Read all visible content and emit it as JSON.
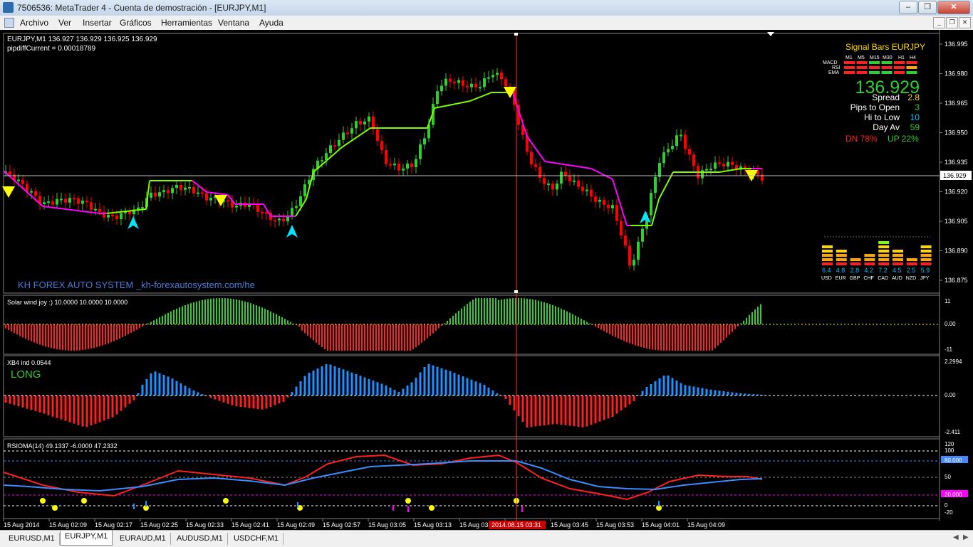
{
  "window": {
    "title": "7506536: MetaTrader 4 - Cuenta de demostración - [EURJPY,M1]"
  },
  "menu": {
    "items": [
      "Archivo",
      "Ver",
      "Insertar",
      "Gráficos",
      "Herramientas",
      "Ventana",
      "Ayuda"
    ]
  },
  "chart": {
    "header": "EURJPY,M1  136.927 136.929 136.925 136.929",
    "pipdiff": "pipdiffCurrent = 0.00018789",
    "watermark": "KH FOREX AUTO SYSTEM _kh-forexautosystem.com/he",
    "current_price": "136.929",
    "price_labels": [
      "136.995",
      "136.980",
      "136.965",
      "136.950",
      "136.935",
      "136.920",
      "136.905",
      "136.890",
      "136.875"
    ],
    "time_labels": [
      "15 Aug 2014",
      "15 Aug 02:09",
      "15 Aug 02:17",
      "15 Aug 02:25",
      "15 Aug 02:33",
      "15 Aug 02:41",
      "15 Aug 02:49",
      "15 Aug 02:57",
      "15 Aug 03:05",
      "15 Aug 03:13",
      "15 Aug 03",
      "15 Aug 03:37",
      "15 Aug 03:45",
      "15 Aug 03:53",
      "15 Aug 04:01",
      "15 Aug 04:09"
    ],
    "crosshair_time": "2014.08.15 03:31"
  },
  "signal_panel": {
    "title": "Signal Bars EURJPY",
    "timeframes": [
      "M1",
      "M5",
      "M15",
      "M30",
      "H1",
      "H4"
    ],
    "rows": [
      "MACD",
      "RSI",
      "EMA"
    ],
    "price": "136.929",
    "stats": [
      {
        "label": "Spread",
        "value": "2.8"
      },
      {
        "label": "Pips to Open",
        "value": "3"
      },
      {
        "label": "Hi to Low",
        "value": "10"
      },
      {
        "label": "Day Av",
        "value": "59"
      }
    ],
    "dn": "DN 78%",
    "up": "UP 22%"
  },
  "strength": {
    "currencies": [
      "USD",
      "EUR",
      "GBP",
      "CHF",
      "CAD",
      "AUD",
      "NZD",
      "JPY"
    ],
    "values": [
      "6.4",
      "4.8",
      "2.8",
      "4.2",
      "7.2",
      "4.5",
      "2.5",
      "5.9"
    ]
  },
  "solar": {
    "label": "Solar wind joy :) 10.0000 10.0000 10.0000",
    "scale": [
      "11",
      "0.00",
      "-11"
    ]
  },
  "xb4": {
    "label": "XB4 ind 0.0544",
    "signal": "LONG",
    "scale": [
      "2.2994",
      "0.00",
      "-2.411"
    ]
  },
  "rsioma": {
    "label": "RSIOMA(14) 49.1337 -6.0000 47.2332",
    "scale": [
      "120",
      "100",
      "80.000",
      "50",
      "20.000",
      "0",
      "-20"
    ]
  },
  "colors": {
    "bull": "#32cd32",
    "bear": "#ff0000",
    "blue": "#1e90ff",
    "yellow": "#ffff00",
    "magenta": "#ff00ff"
  },
  "tabs": {
    "items": [
      "EURUSD,M1",
      "EURJPY,M1",
      "EURAUD,M1",
      "AUDUSD,M1",
      "USDCHF,M1"
    ],
    "active": 1
  }
}
